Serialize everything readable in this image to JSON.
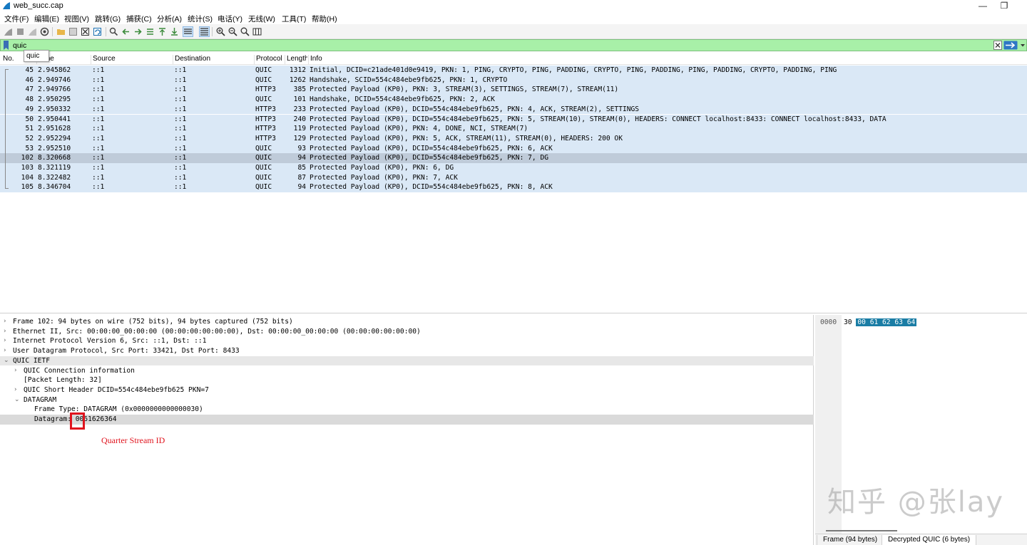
{
  "window": {
    "title": "web_succ.cap"
  },
  "menu": [
    "文件(F)",
    "编辑(E)",
    "视图(V)",
    "跳转(G)",
    "捕获(C)",
    "分析(A)",
    "统计(S)",
    "电话(Y)",
    "无线(W)",
    "工具(T)",
    "帮助(H)"
  ],
  "filter": {
    "value": "quic",
    "suggestion": "quic"
  },
  "packet_list": {
    "columns": [
      "No.",
      "Time",
      "Source",
      "Destination",
      "Protocol",
      "Length",
      "Info"
    ],
    "rows": [
      {
        "no": "45",
        "time": "2.945862",
        "src": "::1",
        "dst": "::1",
        "proto": "QUIC",
        "len": "1312",
        "info": "Initial, DCID=c21ade401d0e9419, PKN: 1, PING, CRYPTO, PING, PADDING, CRYPTO, PING, PADDING, PING, PADDING, CRYPTO, PADDING, PING"
      },
      {
        "no": "46",
        "time": "2.949746",
        "src": "::1",
        "dst": "::1",
        "proto": "QUIC",
        "len": "1262",
        "info": "Handshake, SCID=554c484ebe9fb625, PKN: 1, CRYPTO"
      },
      {
        "no": "47",
        "time": "2.949766",
        "src": "::1",
        "dst": "::1",
        "proto": "HTTP3",
        "len": "385",
        "info": "Protected Payload (KP0), PKN: 3, STREAM(3), SETTINGS, STREAM(7), STREAM(11)"
      },
      {
        "no": "48",
        "time": "2.950295",
        "src": "::1",
        "dst": "::1",
        "proto": "QUIC",
        "len": "101",
        "info": "Handshake, DCID=554c484ebe9fb625, PKN: 2, ACK"
      },
      {
        "no": "49",
        "time": "2.950332",
        "src": "::1",
        "dst": "::1",
        "proto": "HTTP3",
        "len": "233",
        "info": "Protected Payload (KP0), DCID=554c484ebe9fb625, PKN: 4, ACK, STREAM(2), SETTINGS"
      },
      {
        "no": "50",
        "time": "2.950441",
        "src": "::1",
        "dst": "::1",
        "proto": "HTTP3",
        "len": "240",
        "info": "Protected Payload (KP0), DCID=554c484ebe9fb625, PKN: 5, STREAM(10), STREAM(0), HEADERS: CONNECT localhost:8433: CONNECT localhost:8433, DATA"
      },
      {
        "no": "51",
        "time": "2.951628",
        "src": "::1",
        "dst": "::1",
        "proto": "HTTP3",
        "len": "119",
        "info": "Protected Payload (KP0), PKN: 4, DONE, NCI, STREAM(7)"
      },
      {
        "no": "52",
        "time": "2.952294",
        "src": "::1",
        "dst": "::1",
        "proto": "HTTP3",
        "len": "129",
        "info": "Protected Payload (KP0), PKN: 5, ACK, STREAM(11), STREAM(0), HEADERS: 200 OK"
      },
      {
        "no": "53",
        "time": "2.952510",
        "src": "::1",
        "dst": "::1",
        "proto": "QUIC",
        "len": "93",
        "info": "Protected Payload (KP0), DCID=554c484ebe9fb625, PKN: 6, ACK"
      },
      {
        "no": "102",
        "time": "8.320668",
        "src": "::1",
        "dst": "::1",
        "proto": "QUIC",
        "len": "94",
        "info": "Protected Payload (KP0), DCID=554c484ebe9fb625, PKN: 7, DG"
      },
      {
        "no": "103",
        "time": "8.321119",
        "src": "::1",
        "dst": "::1",
        "proto": "QUIC",
        "len": "85",
        "info": "Protected Payload (KP0), PKN: 6, DG"
      },
      {
        "no": "104",
        "time": "8.322482",
        "src": "::1",
        "dst": "::1",
        "proto": "QUIC",
        "len": "87",
        "info": "Protected Payload (KP0), PKN: 7, ACK"
      },
      {
        "no": "105",
        "time": "8.346704",
        "src": "::1",
        "dst": "::1",
        "proto": "QUIC",
        "len": "94",
        "info": "Protected Payload (KP0), DCID=554c484ebe9fb625, PKN: 8, ACK"
      }
    ]
  },
  "details": [
    {
      "level": 0,
      "exp": "›",
      "text": "Frame 102: 94 bytes on wire (752 bits), 94 bytes captured (752 bits)"
    },
    {
      "level": 0,
      "exp": "›",
      "text": "Ethernet II, Src: 00:00:00_00:00:00 (00:00:00:00:00:00), Dst: 00:00:00_00:00:00 (00:00:00:00:00:00)"
    },
    {
      "level": 0,
      "exp": "›",
      "text": "Internet Protocol Version 6, Src: ::1, Dst: ::1"
    },
    {
      "level": 0,
      "exp": "›",
      "text": "User Datagram Protocol, Src Port: 33421, Dst Port: 8433"
    },
    {
      "level": 0,
      "exp": "⌄",
      "text": "QUIC IETF"
    },
    {
      "level": 1,
      "exp": "›",
      "text": "QUIC Connection information"
    },
    {
      "level": 1,
      "exp": "",
      "text": "[Packet Length: 32]"
    },
    {
      "level": 1,
      "exp": "›",
      "text": "QUIC Short Header DCID=554c484ebe9fb625 PKN=7"
    },
    {
      "level": 1,
      "exp": "⌄",
      "text": "DATAGRAM"
    },
    {
      "level": 2,
      "exp": "",
      "text": "Frame Type: DATAGRAM (0x0000000000000030)"
    },
    {
      "level": 2,
      "exp": "",
      "text": "Datagram: 0061626364"
    }
  ],
  "annotation": "Quarter Stream ID",
  "bytes": {
    "offset": "0000",
    "hex_plain": "30",
    "hex_selected": [
      "00",
      "61",
      "62",
      "63",
      "64"
    ],
    "tabs": [
      "Frame (94 bytes)",
      "Decrypted QUIC (6 bytes)"
    ]
  },
  "watermark": "知乎 @张lay",
  "colors": {
    "filter_bg": "#a8f0a8",
    "row_bg": "#dae8f6",
    "selected_row": "#bfcbd9",
    "annotation_red": "#e0141e",
    "hex_selected": "#1a7da5"
  }
}
